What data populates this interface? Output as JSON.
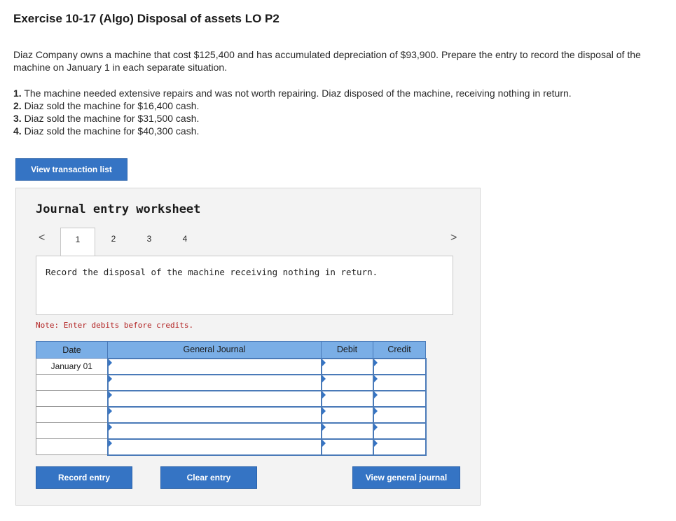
{
  "header": {
    "title": "Exercise 10-17 (Algo) Disposal of assets LO P2"
  },
  "intro": "Diaz Company owns a machine that cost $125,400 and has accumulated depreciation of $93,900. Prepare the entry to record the disposal of the machine on January 1 in each separate situation.",
  "steps": [
    {
      "num": "1.",
      "text": "The machine needed extensive repairs and was not worth repairing. Diaz disposed of the machine, receiving nothing in return."
    },
    {
      "num": "2.",
      "text": "Diaz sold the machine for $16,400 cash."
    },
    {
      "num": "3.",
      "text": "Diaz sold the machine for $31,500 cash."
    },
    {
      "num": "4.",
      "text": "Diaz sold the machine for $40,300 cash."
    }
  ],
  "buttons": {
    "view_transaction_list": "View transaction list",
    "record_entry": "Record entry",
    "clear_entry": "Clear entry",
    "view_general_journal": "View general journal"
  },
  "worksheet": {
    "title": "Journal entry worksheet",
    "prev_glyph": "<",
    "next_glyph": ">",
    "tabs": [
      "1",
      "2",
      "3",
      "4"
    ],
    "active_tab": "1",
    "instruction": "Record the disposal of the machine receiving nothing in return.",
    "note": "Note: Enter debits before credits."
  },
  "journal": {
    "headers": {
      "date": "Date",
      "general_journal": "General Journal",
      "debit": "Debit",
      "credit": "Credit"
    },
    "rows": [
      {
        "date": "January 01"
      },
      {
        "date": ""
      },
      {
        "date": ""
      },
      {
        "date": ""
      },
      {
        "date": ""
      },
      {
        "date": ""
      }
    ]
  },
  "colors": {
    "button": "#3574c4",
    "table_header": "#7aaee6",
    "note": "#b22222"
  }
}
